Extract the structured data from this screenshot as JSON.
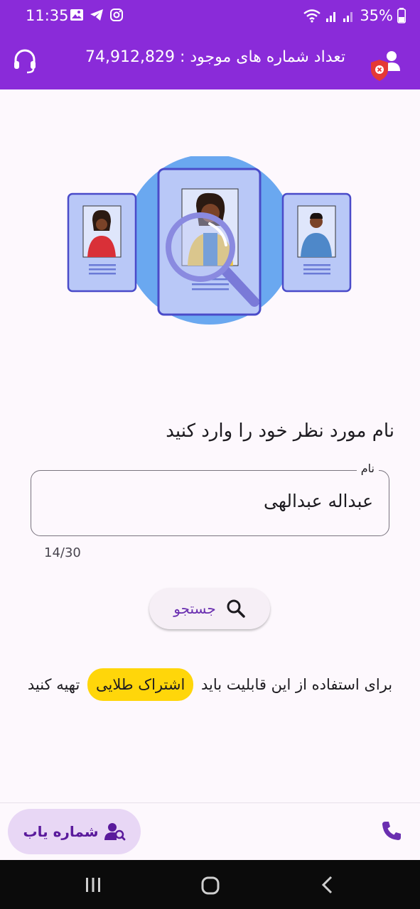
{
  "status_bar": {
    "time": "11:35",
    "battery": "35%",
    "left_icons": [
      "image-icon",
      "telegram-icon",
      "instagram-icon"
    ],
    "right_icons": [
      "wifi-icon",
      "signal-icon",
      "signal-icon",
      "battery-icon"
    ]
  },
  "header": {
    "count_text": "تعداد شماره های موجود : 74,912,829",
    "support_icon": "headset-icon",
    "account_icon": "user-shield-icon"
  },
  "illustration": {
    "name": "profile-cards-search-illustration"
  },
  "search_form": {
    "prompt": "نام مورد نظر خود را وارد کنید",
    "field_label": "نام",
    "field_value": "عبداله عبدالهی",
    "counter": "14/30",
    "search_label": "جستجو",
    "search_icon": "search-icon"
  },
  "subscription": {
    "before": "برای استفاده از این قابلیت باید",
    "highlight": "اشتراک طلایی",
    "after": "تهیه کنید"
  },
  "bottom_nav": {
    "finder_label": "شماره یاب",
    "finder_icon": "person-search-icon",
    "phone_icon": "phone-icon"
  },
  "colors": {
    "primary": "#8a2bd9",
    "gold": "#ffd60a",
    "nav_pill": "#e8d7f5"
  }
}
